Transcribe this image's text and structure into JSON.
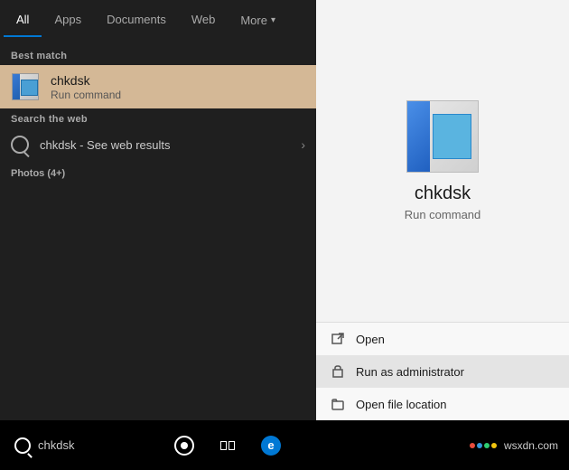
{
  "tabs": {
    "items": [
      {
        "id": "all",
        "label": "All",
        "active": true
      },
      {
        "id": "apps",
        "label": "Apps",
        "active": false
      },
      {
        "id": "documents",
        "label": "Documents",
        "active": false
      },
      {
        "id": "web",
        "label": "Web",
        "active": false
      },
      {
        "id": "more",
        "label": "More",
        "active": false
      }
    ]
  },
  "sections": {
    "best_match_label": "Best match",
    "web_label": "Search the web",
    "photos_label": "Photos (4+)"
  },
  "best_match": {
    "title": "chkdsk",
    "subtitle": "Run command"
  },
  "web_search": {
    "query": "chkdsk",
    "suffix": " - See web results"
  },
  "right_panel": {
    "app_name": "chkdsk",
    "app_type": "Run command"
  },
  "context_menu": {
    "items": [
      {
        "id": "open",
        "label": "Open"
      },
      {
        "id": "run-as-admin",
        "label": "Run as administrator"
      },
      {
        "id": "open-file-location",
        "label": "Open file location"
      }
    ]
  },
  "taskbar": {
    "search_text": "chkdsk",
    "wsxdn_text": "wsxdn.com"
  },
  "colors": {
    "accent": "#0078d4",
    "highlight_bg": "#d4b896",
    "panel_bg": "#1f1f1f",
    "right_bg": "#f3f3f3"
  }
}
